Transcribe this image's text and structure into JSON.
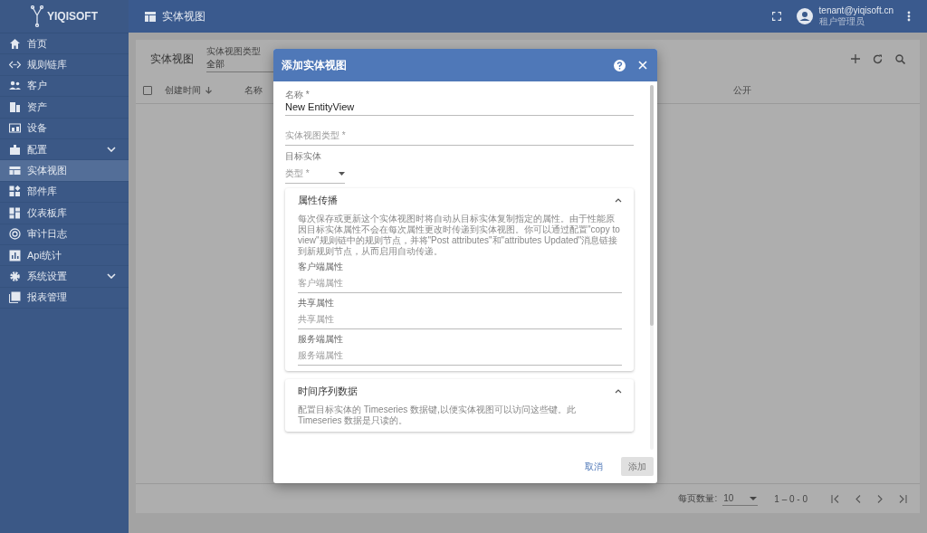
{
  "app": {
    "logo_text": "YIQISOFT"
  },
  "top_bar": {
    "title": "实体视图",
    "user_email": "tenant@yiqisoft.cn",
    "user_role": "租户管理员"
  },
  "sidebar": {
    "items": [
      {
        "label": "首页",
        "selected": false,
        "expandable": false
      },
      {
        "label": "规则链库",
        "selected": false,
        "expandable": false
      },
      {
        "label": "客户",
        "selected": false,
        "expandable": false
      },
      {
        "label": "资产",
        "selected": false,
        "expandable": false
      },
      {
        "label": "设备",
        "selected": false,
        "expandable": false
      },
      {
        "label": "配置",
        "selected": false,
        "expandable": true
      },
      {
        "label": "实体视图",
        "selected": true,
        "expandable": false
      },
      {
        "label": "部件库",
        "selected": false,
        "expandable": false
      },
      {
        "label": "仪表板库",
        "selected": false,
        "expandable": false
      },
      {
        "label": "审计日志",
        "selected": false,
        "expandable": false
      },
      {
        "label": "Api统计",
        "selected": false,
        "expandable": false
      },
      {
        "label": "系统设置",
        "selected": false,
        "expandable": true
      },
      {
        "label": "报表管理",
        "selected": false,
        "expandable": false
      }
    ]
  },
  "list": {
    "title": "实体视图",
    "select_all": {
      "checked": false
    },
    "filter": {
      "label": "实体视图类型",
      "value": "全部"
    },
    "columns": [
      {
        "label": "创建时间",
        "sorted": true
      },
      {
        "label": "名称",
        "sorted": false
      },
      {
        "label": "公开",
        "sorted": false
      }
    ],
    "paginator": {
      "page_size_label": "每页数量:",
      "page_size": "10",
      "range": "1 – 0 - 0"
    }
  },
  "dialog": {
    "title": "添加实体视图",
    "name_field": {
      "label": "名称 *",
      "value": "New EntityView"
    },
    "type_field": {
      "placeholder": "实体视图类型 *"
    },
    "target_label": "目标实体",
    "target_type": {
      "placeholder": "类型 *"
    },
    "attributes_panel": {
      "title": "属性传播",
      "expanded": true,
      "description": "每次保存或更新这个实体视图时将自动从目标实体复制指定的属性。由于性能原因目标实体属性不会在每次属性更改时传递到实体视图。你可以通过配置\"copy to view\"规则链中的规则节点，并将\"Post attributes\"和\"attributes Updated\"消息链接到新规则节点，从而启用自动传递。",
      "fields": [
        {
          "label": "客户端属性",
          "placeholder": "客户端属性"
        },
        {
          "label": "共享属性",
          "placeholder": "共享属性"
        },
        {
          "label": "服务端属性",
          "placeholder": "服务端属性"
        }
      ]
    },
    "timeseries_panel": {
      "title": "时间序列数据",
      "expanded": true,
      "description": "配置目标实体的 Timeseries 数据键,以便实体视图可以访问这些键。此 Timeseries 数据是只读的。"
    },
    "cancel_button": "取消",
    "add_button": {
      "label": "添加",
      "disabled": true
    }
  }
}
